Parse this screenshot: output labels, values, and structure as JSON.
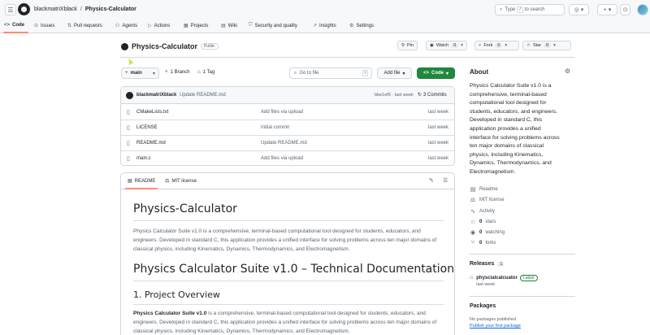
{
  "header": {
    "owner": "blackmatriXblack",
    "separator": "/",
    "repo": "Physics-Calculator",
    "search_placeholder": "Type",
    "search_key": "/",
    "search_suffix": "to search"
  },
  "nav": {
    "tabs": [
      {
        "label": "Code",
        "icon": "code-icon"
      },
      {
        "label": "Issues",
        "icon": "issue-icon"
      },
      {
        "label": "Pull requests",
        "icon": "pull-request-icon"
      },
      {
        "label": "Agents",
        "icon": "agent-icon"
      },
      {
        "label": "Actions",
        "icon": "play-icon"
      },
      {
        "label": "Projects",
        "icon": "table-icon"
      },
      {
        "label": "Wiki",
        "icon": "book-icon"
      },
      {
        "label": "Security and quality",
        "icon": "shield-icon"
      },
      {
        "label": "Insights",
        "icon": "graph-icon"
      },
      {
        "label": "Settings",
        "icon": "gear-icon"
      }
    ]
  },
  "repo": {
    "name": "Physics-Calculator",
    "visibility": "Public",
    "pin": "Pin",
    "watch": "Watch",
    "watch_count": "0",
    "fork": "Fork",
    "fork_count": "0",
    "star": "Star",
    "star_count": "0"
  },
  "toolbar": {
    "branch": "main",
    "branches": "1 Branch",
    "tags": "1 Tag",
    "goto_placeholder": "Go to file",
    "goto_key": "t",
    "add_file": "Add file",
    "code": "Code"
  },
  "commit": {
    "author": "blackmatriXblack",
    "message": "Update README.md",
    "hash": "bbe1ef5 · last week",
    "commits": "3 Commits"
  },
  "files": [
    {
      "name": "CMakeLists.txt",
      "message": "Add files via upload",
      "when": "last week"
    },
    {
      "name": "LICENSE",
      "message": "Initial commit",
      "when": "last week"
    },
    {
      "name": "README.md",
      "message": "Update README.md",
      "when": "last week"
    },
    {
      "name": "main.c",
      "message": "Add files via upload",
      "when": "last week"
    }
  ],
  "readme": {
    "tab_readme": "README",
    "tab_license": "MIT license",
    "h1": "Physics-Calculator",
    "p1": "Physics Calculator Suite v1.0 is a comprehensive, terminal-based computational tool designed for students, educators, and engineers. Developed in standard C, this application provides a unified interface for solving problems across ten major domains of classical physics, including Kinematics, Dynamics, Thermodynamics, and Electromagnetism.",
    "h1b": "Physics Calculator Suite v1.0 – Technical Documentation",
    "h2": "1. Project Overview",
    "p2_bold": "Physics Calculator Suite v1.0",
    "p2_rest": " is a comprehensive, terminal-based computational tool designed for students, educators, and engineers. Developed in standard C, this application provides a unified interface for solving problems across ten major domains of classical physics, including Kinematics, Dynamics, Thermodynamics, and Electromagnetism."
  },
  "about": {
    "title": "About",
    "description": "Physics Calculator Suite v1.0 is a comprehensive, terminal-based computational tool designed for students, educators, and engineers. Developed in standard C, this application provides a unified interface for solving problems across ten major domains of classical physics, including Kinematics, Dynamics, Thermodynamics, and Electromagnetism.",
    "readme": "Readme",
    "license": "MIT license",
    "activity": "Activity",
    "stars_n": "0",
    "stars": "stars",
    "watching_n": "0",
    "watching": "watching",
    "forks_n": "0",
    "forks": "forks"
  },
  "releases": {
    "title": "Releases",
    "count": "1",
    "name": "physcialcalcuator",
    "badge": "Latest",
    "when": "last week"
  },
  "packages": {
    "title": "Packages",
    "none": "No packages published",
    "link": "Publish your first package"
  }
}
